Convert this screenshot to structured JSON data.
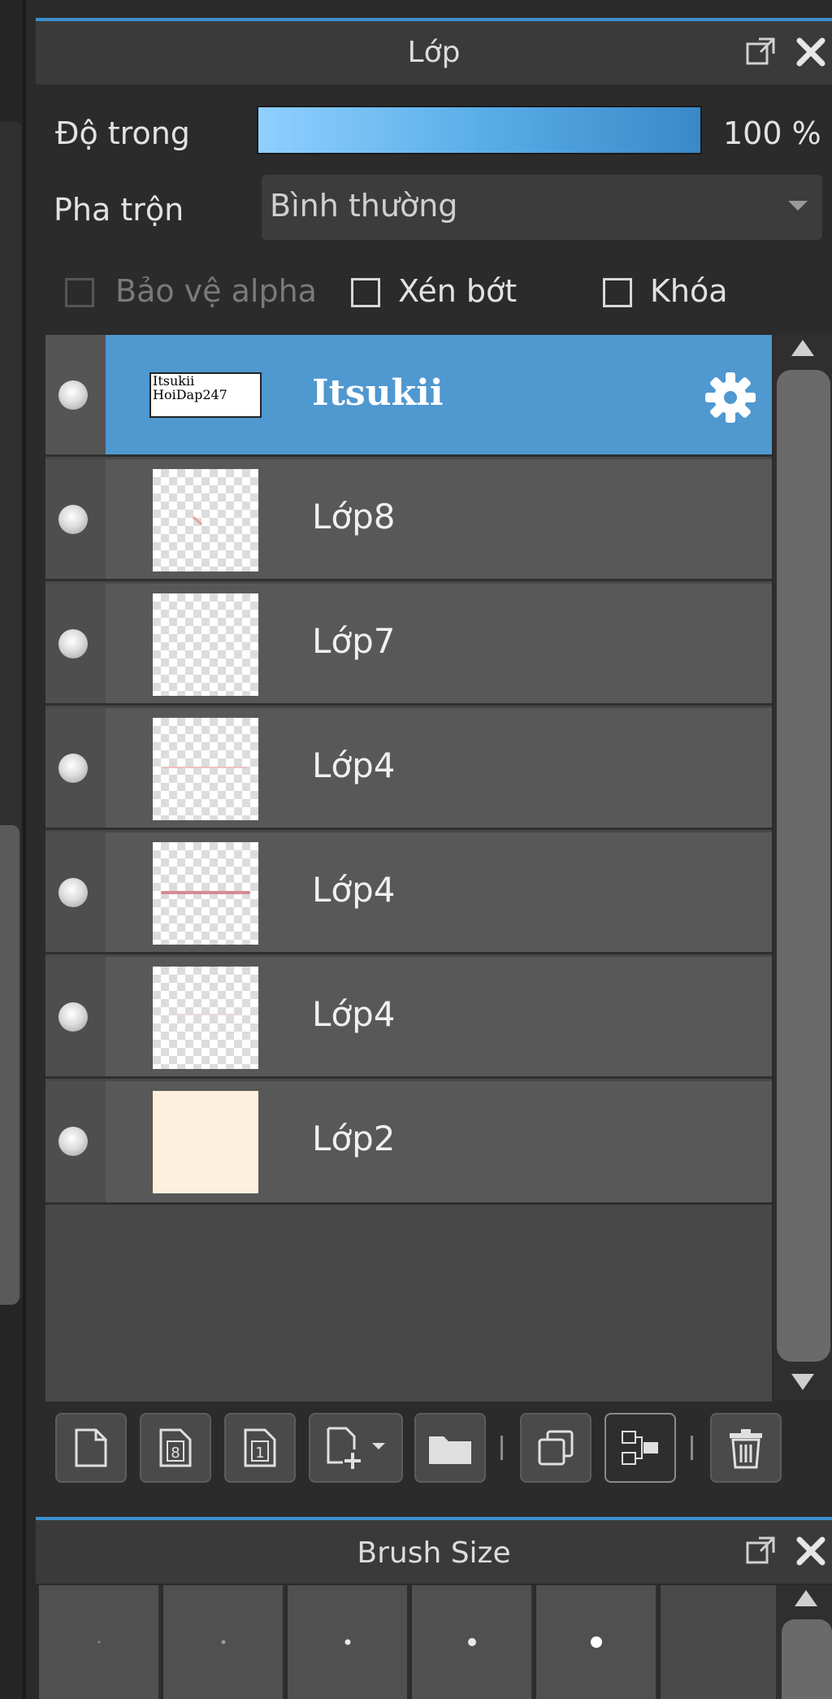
{
  "layers_panel": {
    "title": "Lớp",
    "opacity_label": "Độ trong",
    "opacity_value": "100 %",
    "opacity_fraction": 1.0,
    "blend_label": "Pha trộn",
    "blend_value": "Bình thường",
    "checkboxes": [
      {
        "label": "Bảo vệ alpha",
        "checked": false,
        "enabled": false
      },
      {
        "label": "Xén bớt",
        "checked": false,
        "enabled": true
      },
      {
        "label": "Khóa",
        "checked": false,
        "enabled": true
      }
    ],
    "layers": [
      {
        "name": "Itsukii",
        "selected": true,
        "thumb_text": [
          "Itsukii",
          "HoiDap247"
        ]
      },
      {
        "name": "Lớp8",
        "selected": false
      },
      {
        "name": "Lớp7",
        "selected": false
      },
      {
        "name": "Lớp4",
        "selected": false
      },
      {
        "name": "Lớp4",
        "selected": false
      },
      {
        "name": "Lớp4",
        "selected": false
      },
      {
        "name": "Lớp2",
        "selected": false
      }
    ],
    "toolbar_icons": [
      "new-layer-icon",
      "new-8bit-layer-icon",
      "new-1bit-layer-icon",
      "add-layer-dropdown-icon",
      "folder-icon",
      "duplicate-layer-icon",
      "merge-down-icon",
      "trash-icon"
    ]
  },
  "brush_panel": {
    "title": "Brush Size"
  },
  "colors": {
    "accent": "#3d8fcf",
    "selected_row": "#4f98d0",
    "panel_bg": "#2b2b2b",
    "row_bg": "#585858"
  }
}
